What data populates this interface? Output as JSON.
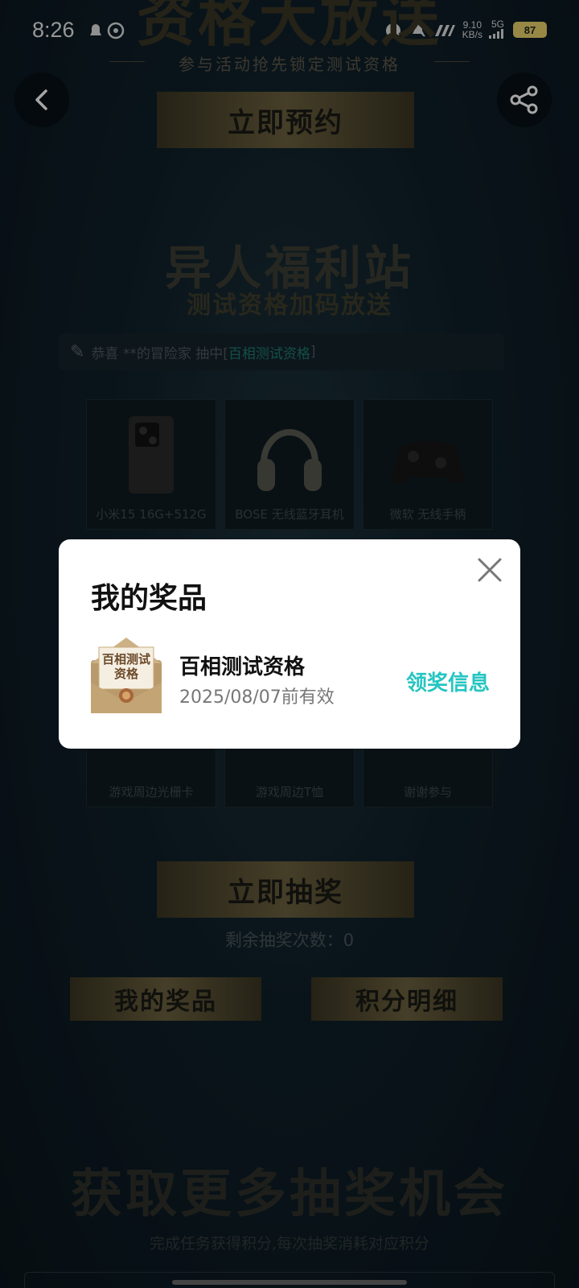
{
  "status_bar": {
    "time": "8:26",
    "net_speed": "9.10",
    "net_unit": "KB/s",
    "net_type": "5G",
    "battery": "87"
  },
  "hero": {
    "title": "资格大放送",
    "subtitle": "参与活动抢先锁定测试资格",
    "reserve_label": "立即预约"
  },
  "welfare": {
    "title": "异人福利站",
    "subtitle": "测试资格加码放送",
    "ticker_prefix": "恭喜 **的冒险家 抽中[",
    "ticker_prize": "百相测试资格",
    "ticker_suffix": "]"
  },
  "prize_grid": {
    "top_row": [
      {
        "label": "小米15 16G+512G",
        "icon": "phone-image"
      },
      {
        "label": "BOSE 无线蓝牙耳机",
        "icon": "headphones-image"
      },
      {
        "label": "微软 无线手柄",
        "icon": "controller-image"
      }
    ],
    "bottom_row": [
      {
        "label": "游戏周边光栅卡"
      },
      {
        "label": "游戏周边T恤"
      },
      {
        "label": "谢谢参与"
      }
    ]
  },
  "draw": {
    "draw_label": "立即抽奖",
    "remaining_label": "剩余抽奖次数：0",
    "my_prizes_label": "我的奖品",
    "points_label": "积分明细"
  },
  "more": {
    "title": "获取更多抽奖机会",
    "subtitle": "完成任务获得积分,每次抽奖消耗对应积分"
  },
  "modal": {
    "title": "我的奖品",
    "prize_name": "百相测试资格",
    "prize_valid": "2025/08/07前有效",
    "claim_label": "领奖信息",
    "envelope_text": "百相测试资格",
    "accent_color": "#25c5c2"
  }
}
